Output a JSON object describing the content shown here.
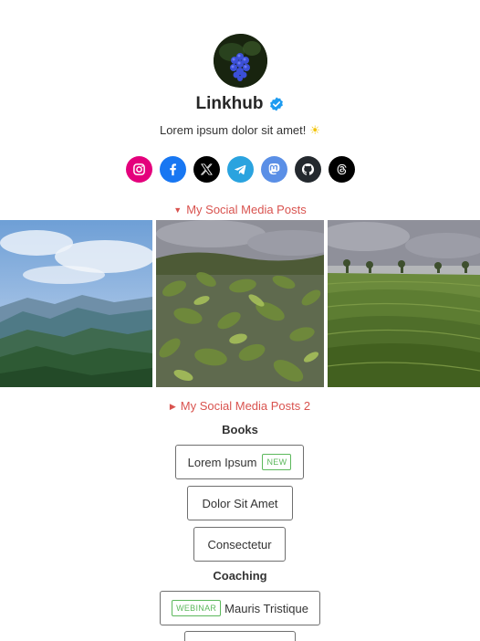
{
  "profile": {
    "name": "Linkhub",
    "bio": "Lorem ipsum dolor sit amet!",
    "bio_emoji": "☀"
  },
  "socials": [
    {
      "name": "instagram-icon",
      "color": "#e4007c"
    },
    {
      "name": "facebook-icon",
      "color": "#1877f2"
    },
    {
      "name": "x-icon",
      "color": "#000000"
    },
    {
      "name": "telegram-icon",
      "color": "#2aa3df"
    },
    {
      "name": "mastodon-icon",
      "color": "#5a8fe6"
    },
    {
      "name": "github-icon",
      "color": "#24292e"
    },
    {
      "name": "threads-icon",
      "color": "#000000"
    }
  ],
  "sections": {
    "posts_1": {
      "label": "My Social Media Posts",
      "state": "expanded"
    },
    "posts_2": {
      "label": "My Social Media Posts 2",
      "state": "collapsed"
    }
  },
  "groups": {
    "books": {
      "heading": "Books",
      "links": [
        {
          "label": "Lorem Ipsum",
          "badge": "NEW"
        },
        {
          "label": "Dolor Sit Amet"
        },
        {
          "label": "Consectetur"
        }
      ]
    },
    "coaching": {
      "heading": "Coaching",
      "links": [
        {
          "label": "Mauris Tristique",
          "badge": "WEBINAR"
        }
      ]
    }
  },
  "colors": {
    "accent": "#d9534f",
    "badge": "#5cb85c",
    "verified": "#1d9bf0"
  },
  "toggle_glyphs": {
    "expanded": "▼",
    "collapsed": "▶"
  }
}
